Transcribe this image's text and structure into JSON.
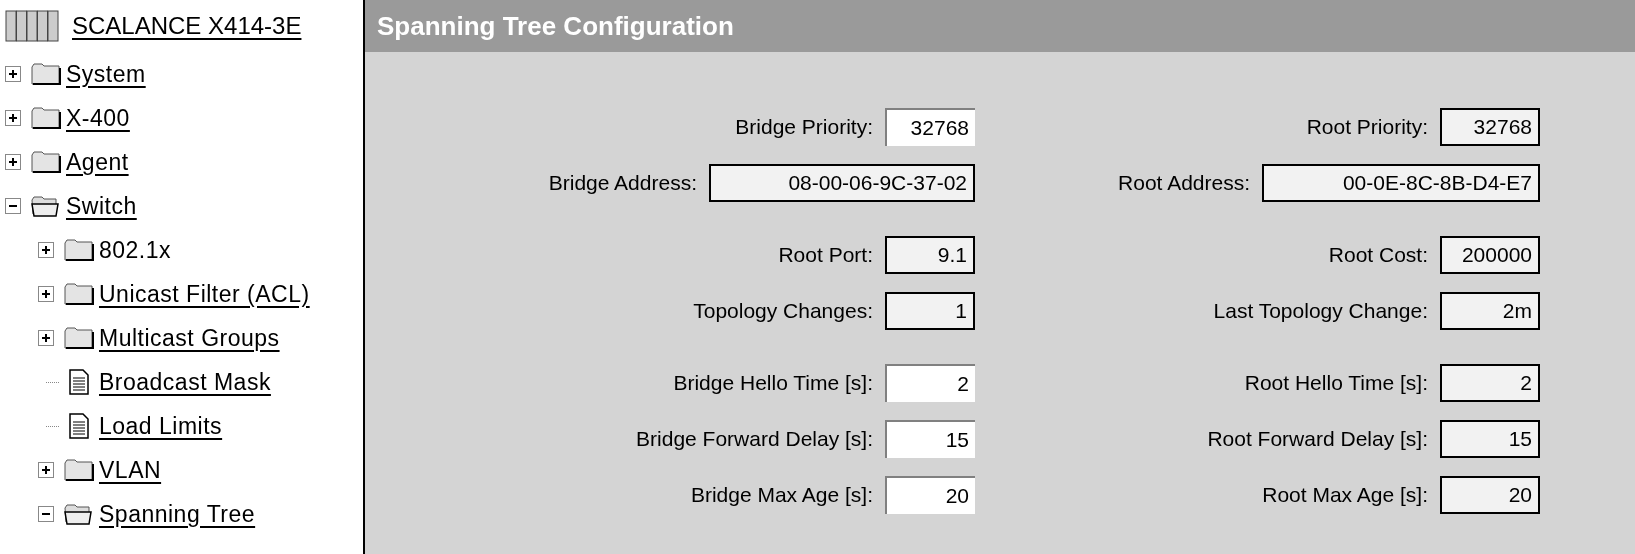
{
  "tree": {
    "label": "SCALANCE X414-3E",
    "children": [
      {
        "label": "System",
        "kind": "folder",
        "expanded": false,
        "link": true
      },
      {
        "label": "X-400",
        "kind": "folder",
        "expanded": false,
        "link": true
      },
      {
        "label": "Agent",
        "kind": "folder",
        "expanded": false,
        "link": true
      },
      {
        "label": "Switch",
        "kind": "folder",
        "expanded": true,
        "link": true,
        "children": [
          {
            "label": "802.1x",
            "kind": "folder",
            "expanded": false,
            "link": false
          },
          {
            "label": "Unicast Filter (ACL)",
            "kind": "folder",
            "expanded": false,
            "link": true
          },
          {
            "label": "Multicast Groups",
            "kind": "folder",
            "expanded": false,
            "link": true
          },
          {
            "label": "Broadcast Mask",
            "kind": "page",
            "link": true
          },
          {
            "label": "Load Limits",
            "kind": "page",
            "link": true
          },
          {
            "label": "VLAN",
            "kind": "folder",
            "expanded": false,
            "link": true
          },
          {
            "label": "Spanning Tree",
            "kind": "folder",
            "expanded": true,
            "link": true
          }
        ]
      }
    ]
  },
  "page": {
    "title": "Spanning Tree Configuration",
    "groups": [
      {
        "rows": [
          {
            "left": {
              "label": "Bridge Priority:",
              "value": "32768",
              "editable": true,
              "kind": "number"
            },
            "right": {
              "label": "Root Priority:",
              "value": "32768",
              "editable": false,
              "kind": "number"
            }
          },
          {
            "left": {
              "label": "Bridge Address:",
              "value": "08-00-06-9C-37-02",
              "editable": false,
              "kind": "address"
            },
            "right": {
              "label": "Root Address:",
              "value": "00-0E-8C-8B-D4-E7",
              "editable": false,
              "kind": "address"
            }
          }
        ]
      },
      {
        "rows": [
          {
            "left": {
              "label": "Root Port:",
              "value": "9.1",
              "editable": false,
              "kind": "number"
            },
            "right": {
              "label": "Root Cost:",
              "value": "200000",
              "editable": false,
              "kind": "number"
            }
          },
          {
            "left": {
              "label": "Topology Changes:",
              "value": "1",
              "editable": false,
              "kind": "number"
            },
            "right": {
              "label": "Last Topology Change:",
              "value": "2m",
              "editable": false,
              "kind": "number"
            }
          }
        ]
      },
      {
        "rows": [
          {
            "left": {
              "label": "Bridge Hello Time [s]:",
              "value": "2",
              "editable": true,
              "kind": "number"
            },
            "right": {
              "label": "Root Hello Time [s]:",
              "value": "2",
              "editable": false,
              "kind": "number"
            }
          },
          {
            "left": {
              "label": "Bridge Forward Delay [s]:",
              "value": "15",
              "editable": true,
              "kind": "number"
            },
            "right": {
              "label": "Root Forward Delay [s]:",
              "value": "15",
              "editable": false,
              "kind": "number"
            }
          },
          {
            "left": {
              "label": "Bridge Max Age [s]:",
              "value": "20",
              "editable": true,
              "kind": "number"
            },
            "right": {
              "label": "Root Max Age [s]:",
              "value": "20",
              "editable": false,
              "kind": "number"
            }
          }
        ]
      }
    ]
  }
}
